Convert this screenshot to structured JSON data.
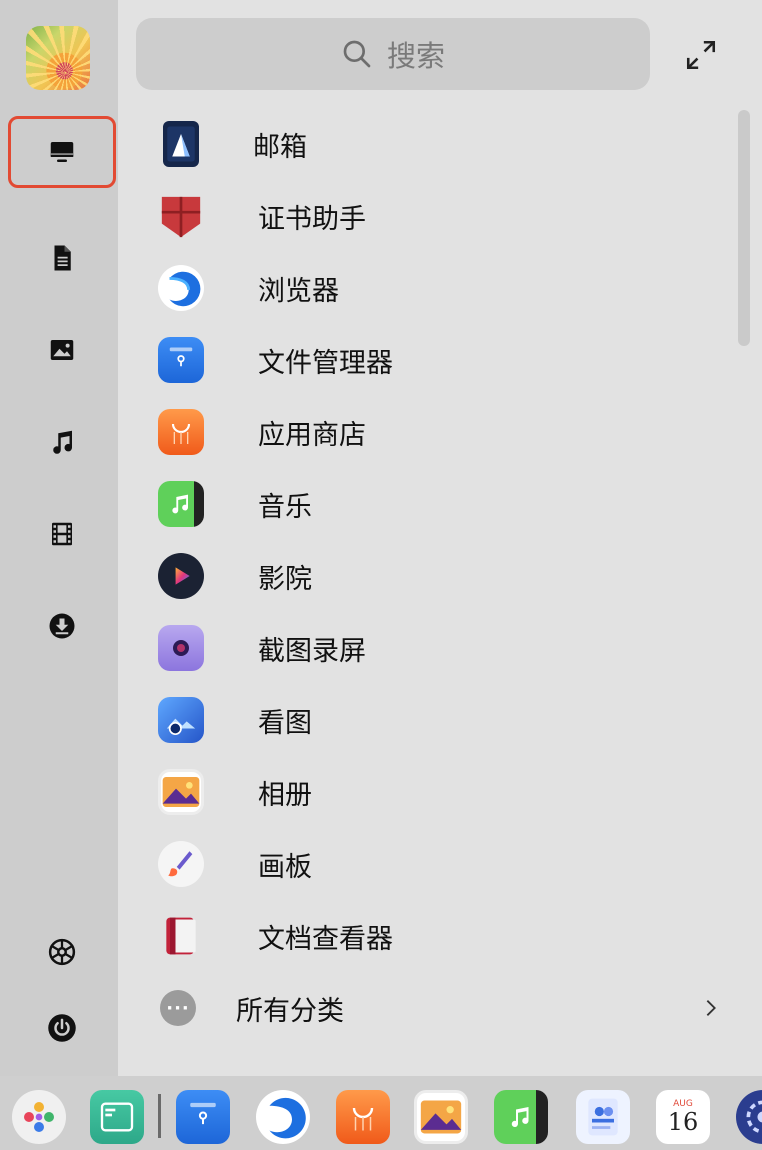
{
  "search": {
    "placeholder": "搜索"
  },
  "sidebar": {
    "items": [
      {
        "icon": "computer-icon",
        "active": true
      },
      {
        "icon": "document-icon"
      },
      {
        "icon": "picture-icon"
      },
      {
        "icon": "music-icon"
      },
      {
        "icon": "video-icon"
      },
      {
        "icon": "download-icon"
      },
      {
        "icon": "settings-icon"
      },
      {
        "icon": "power-icon"
      }
    ]
  },
  "apps": [
    {
      "name": "邮箱",
      "icon": "mail-icon"
    },
    {
      "name": "证书助手",
      "icon": "certificate-icon"
    },
    {
      "name": "浏览器",
      "icon": "browser-icon"
    },
    {
      "name": "文件管理器",
      "icon": "file-manager-icon"
    },
    {
      "name": "应用商店",
      "icon": "app-store-icon"
    },
    {
      "name": "音乐",
      "icon": "music-app-icon"
    },
    {
      "name": "影院",
      "icon": "cinema-icon"
    },
    {
      "name": "截图录屏",
      "icon": "screenshot-icon"
    },
    {
      "name": "看图",
      "icon": "image-viewer-icon"
    },
    {
      "name": "相册",
      "icon": "album-icon"
    },
    {
      "name": "画板",
      "icon": "drawing-board-icon"
    },
    {
      "name": "文档查看器",
      "icon": "document-viewer-icon"
    }
  ],
  "all_categories": {
    "label": "所有分类"
  },
  "dock": {
    "calendar_day": "16",
    "items": [
      "launcher-icon",
      "multitask-view-icon",
      "file-manager-icon",
      "browser-icon",
      "app-store-icon",
      "album-icon",
      "music-app-icon",
      "contacts-icon",
      "calendar-icon",
      "settings-icon"
    ]
  },
  "colors": {
    "active_border": "#e24a33",
    "rail_bg": "#cdcdcd",
    "panel_bg": "#e2e2e2"
  }
}
